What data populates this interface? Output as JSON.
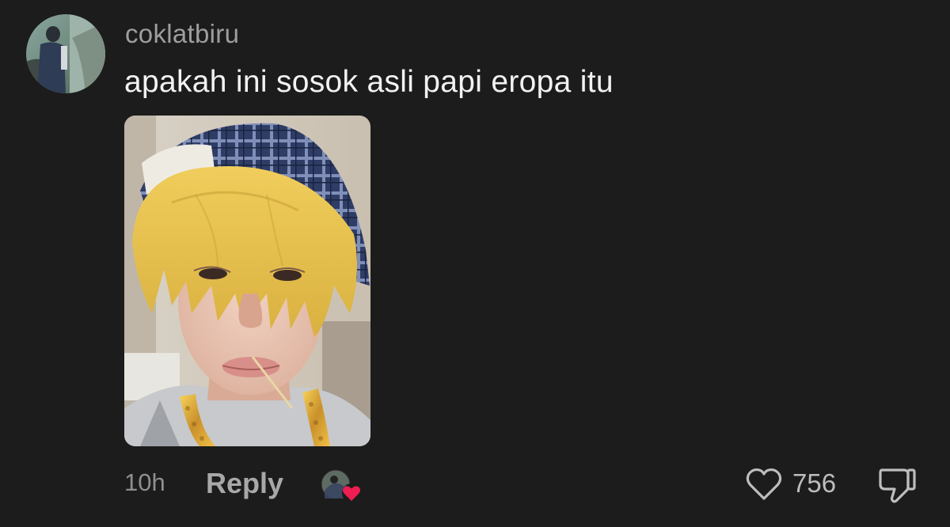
{
  "comment": {
    "username": "coklatbiru",
    "text": "apakah ini sosok asli papi eropa itu",
    "attachment": {
      "type": "photo",
      "content": "selfie of person with blond wig, plaid cap and gold chain"
    }
  },
  "footer": {
    "time": "10h",
    "reply_label": "Reply",
    "creator_liked": true,
    "like_count": "756",
    "icons": {
      "creator_like": "creator-avatar-heart-icon",
      "like": "heart-outline-icon",
      "dislike": "thumbs-down-icon"
    }
  },
  "colors": {
    "background": "#1c1c1c",
    "username": "#9e9e9e",
    "text": "#f2f2f2",
    "heart_badge": "#ee1d52"
  }
}
